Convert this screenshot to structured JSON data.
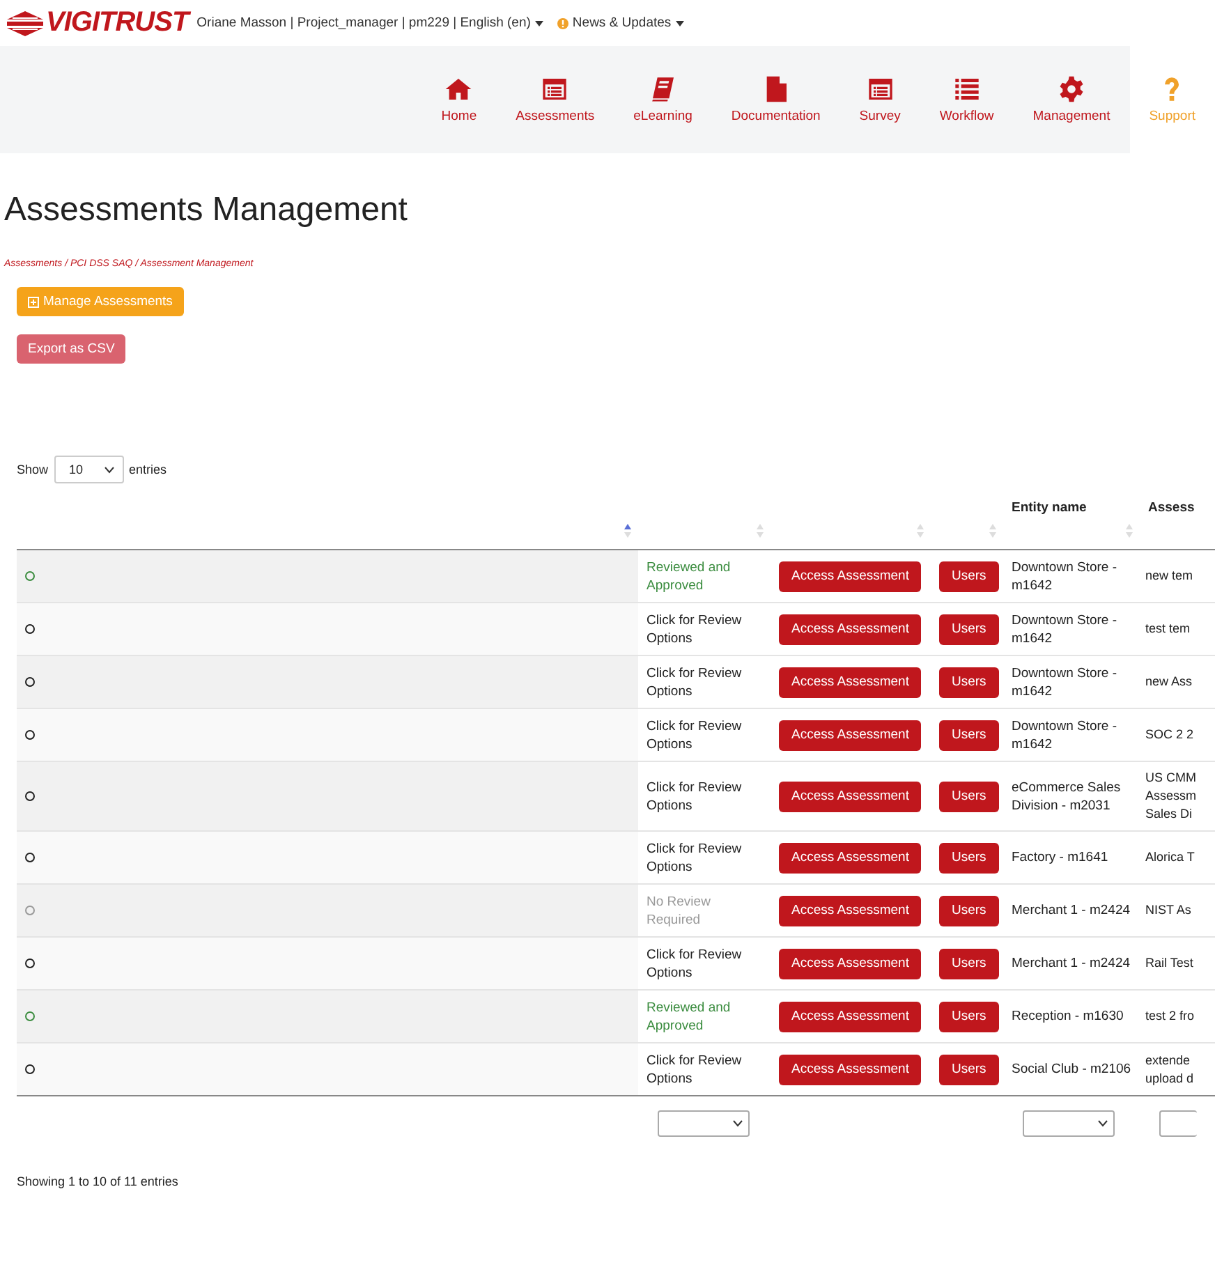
{
  "header": {
    "logo": "VIGITRUST",
    "user_menu": "Oriane Masson | Project_manager | pm229 | English (en)",
    "news_menu": "News & Updates"
  },
  "nav": [
    {
      "label": "Home",
      "selected": false
    },
    {
      "label": "Assessments",
      "selected": false
    },
    {
      "label": "eLearning",
      "selected": false
    },
    {
      "label": "Documentation",
      "selected": false
    },
    {
      "label": "Survey",
      "selected": false
    },
    {
      "label": "Workflow",
      "selected": false
    },
    {
      "label": "Management",
      "selected": false
    },
    {
      "label": "Support",
      "selected": true
    }
  ],
  "page_title": "Assessments Management",
  "breadcrumb": "Assessments / PCI DSS SAQ / Assessment Management",
  "actions": [
    {
      "label": "Manage Assessments",
      "kind": "manage"
    },
    {
      "label": "Export as CSV",
      "kind": "export"
    }
  ],
  "length_menu": {
    "before": "Show",
    "value": "10",
    "after": "entries"
  },
  "table": {
    "columns": [
      {
        "sorted": true,
        "filter": false
      },
      {
        "sorted": false,
        "filter": true
      },
      {
        "sorted": false,
        "filter": false
      },
      {
        "sorted": false,
        "filter": false
      },
      {
        "label": "Entity name",
        "sorted": false,
        "filter": true
      },
      {
        "label": "Assess",
        "filter": true
      }
    ],
    "rows": [
      {
        "color": "#3c8d40",
        "review": {
          "kind": "approved",
          "text": "Reviewed and Approved"
        },
        "access": "Access Assessment",
        "users": "Users",
        "entity": "Downtown Store - m1642",
        "assessment": "new tem"
      },
      {
        "color": "#222222",
        "review": {
          "kind": "review",
          "text": "Click for Review Options"
        },
        "access": "Access Assessment",
        "users": "Users",
        "entity": "Downtown Store - m1642",
        "assessment": "test tem"
      },
      {
        "color": "#222222",
        "review": {
          "kind": "review",
          "text": "Click for Review Options"
        },
        "access": "Access Assessment",
        "users": "Users",
        "entity": "Downtown Store - m1642",
        "assessment": "new Ass"
      },
      {
        "color": "#222222",
        "review": {
          "kind": "review",
          "text": "Click for Review Options"
        },
        "access": "Access Assessment",
        "users": "Users",
        "entity": "Downtown Store - m1642",
        "assessment": "SOC 2 2"
      },
      {
        "color": "#222222",
        "review": {
          "kind": "review",
          "text": "Click for Review Options"
        },
        "access": "Access Assessment",
        "users": "Users",
        "entity": "eCommerce Sales Division - m2031",
        "assessment": "US CMM\nAssessm\nSales Di"
      },
      {
        "color": "#222222",
        "review": {
          "kind": "review",
          "text": "Click for Review Options"
        },
        "access": "Access Assessment",
        "users": "Users",
        "entity": "Factory - m1641",
        "assessment": "Alorica T"
      },
      {
        "color": "#999999",
        "review": {
          "kind": "none",
          "text": "No Review Required"
        },
        "access": "Access Assessment",
        "users": "Users",
        "entity": "Merchant 1 - m2424",
        "assessment": "NIST As"
      },
      {
        "color": "#222222",
        "review": {
          "kind": "review",
          "text": "Click for Review Options"
        },
        "access": "Access Assessment",
        "users": "Users",
        "entity": "Merchant 1 - m2424",
        "assessment": "Rail Test"
      },
      {
        "color": "#3c8d40",
        "review": {
          "kind": "approved",
          "text": "Reviewed and Approved"
        },
        "access": "Access Assessment",
        "users": "Users",
        "entity": "Reception - m1630",
        "assessment": "test 2 fro"
      },
      {
        "color": "#222222",
        "review": {
          "kind": "review",
          "text": "Click for Review Options"
        },
        "access": "Access Assessment",
        "users": "Users",
        "entity": "Social Club - m2106",
        "assessment": "extende\nupload d"
      }
    ]
  },
  "info": "Showing 1 to 10 of 11 entries"
}
